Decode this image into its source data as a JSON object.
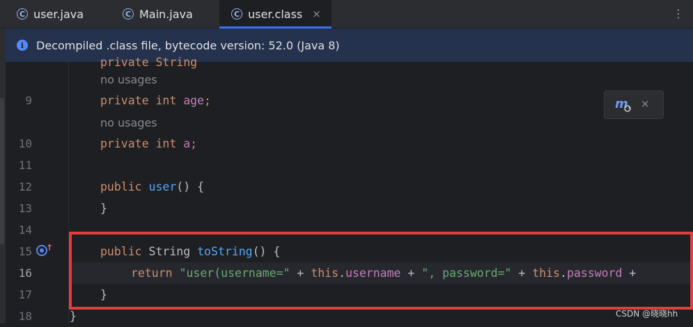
{
  "tabs": [
    {
      "icon": "class-icon",
      "icon_letter": "C",
      "label": "user.java",
      "active": false
    },
    {
      "icon": "class-icon",
      "icon_letter": "C",
      "label": "Main.java",
      "active": false
    },
    {
      "icon": "class-icon",
      "icon_letter": "C",
      "label": "user.class",
      "active": true,
      "close": "×"
    }
  ],
  "tab_more": "⋮",
  "banner": {
    "icon": "info-icon",
    "icon_glyph": "i",
    "text": "Decompiled .class file, bytecode version: 52.0 (Java 8)"
  },
  "hints": {
    "no_usages_1": "no usages",
    "no_usages_2": "no usages"
  },
  "line_numbers": {
    "l9": "9",
    "l10": "10",
    "l11": "11",
    "l12": "12",
    "l13": "13",
    "l14": "14",
    "l15": "15",
    "l16": "16",
    "l17": "17",
    "l18": "18"
  },
  "code": {
    "line9": {
      "kw": "private int ",
      "field": "age",
      "rest": ";"
    },
    "line10": {
      "kw": "private int ",
      "field": "a",
      "rest": ";"
    },
    "line12": {
      "kw": "public ",
      "fn": "user",
      "rest": "() {"
    },
    "line13": {
      "rest": "}"
    },
    "line15": {
      "kw": "public ",
      "type": "String ",
      "fn": "toString",
      "rest": "() {"
    },
    "line16": {
      "kw": "return ",
      "s1": "\"user(username=\"",
      "p1": " + ",
      "t1": "this",
      "d1": ".",
      "f1": "username",
      "p2": " + ",
      "s2": "\", password=\"",
      "p3": " + ",
      "t2": "this",
      "d2": ".",
      "f2": "password",
      "p4": " +"
    },
    "line17": {
      "rest": "}"
    },
    "line18": {
      "rest": "}"
    }
  },
  "widget": {
    "icon": "maven-reload-icon",
    "close": "×"
  },
  "watermark": "CSDN @晓晓hh",
  "colors": {
    "accent": "#3574f0",
    "highlight_box": "#e43d3d",
    "keyword": "#cf8e6d",
    "field": "#c77dbb",
    "function": "#56a8f5",
    "string": "#6aab73"
  }
}
